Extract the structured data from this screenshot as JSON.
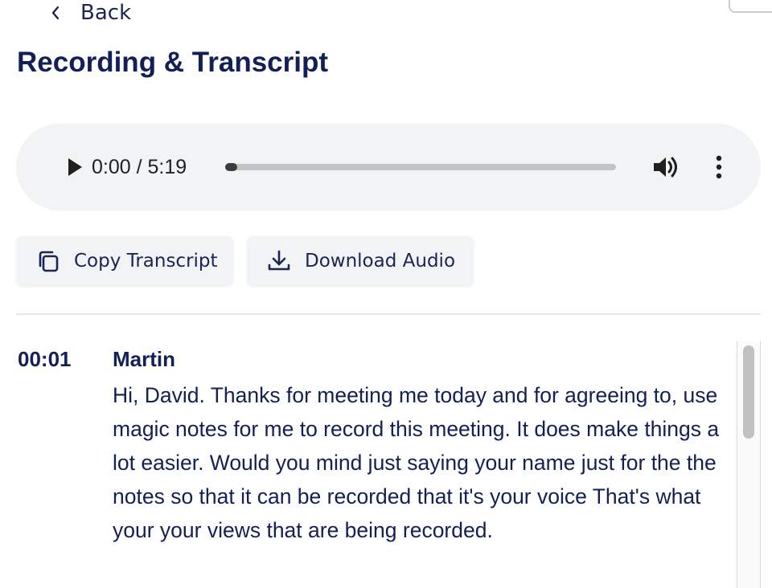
{
  "nav": {
    "back_label": "Back",
    "back_icon": "chevron-left-icon"
  },
  "page": {
    "title": "Recording & Transcript"
  },
  "audio_player": {
    "current_time": "0:00",
    "duration": "5:19",
    "time_text": "0:00 / 5:19",
    "progress_fraction": 0,
    "icons": {
      "play": "play-icon",
      "volume": "volume-icon",
      "more": "more-vertical-icon"
    }
  },
  "actions": {
    "copy_label": "Copy Transcript",
    "copy_icon": "copy-icon",
    "download_label": "Download Audio",
    "download_icon": "download-icon"
  },
  "transcript": {
    "entries": [
      {
        "timestamp": "00:01",
        "speaker": "Martin",
        "text": "Hi, David. Thanks for meeting me today and for agreeing to, use magic notes for me to record this meeting. It does make things a lot easier. Would you mind just saying your name just for the the notes so that it can be recorded that it's your voice That's what your your views that are being recorded."
      }
    ]
  },
  "colors": {
    "text_primary": "#131f57",
    "player_background": "#f1f3f4",
    "button_background": "#f1f3f4",
    "divider": "#e5e7eb"
  }
}
